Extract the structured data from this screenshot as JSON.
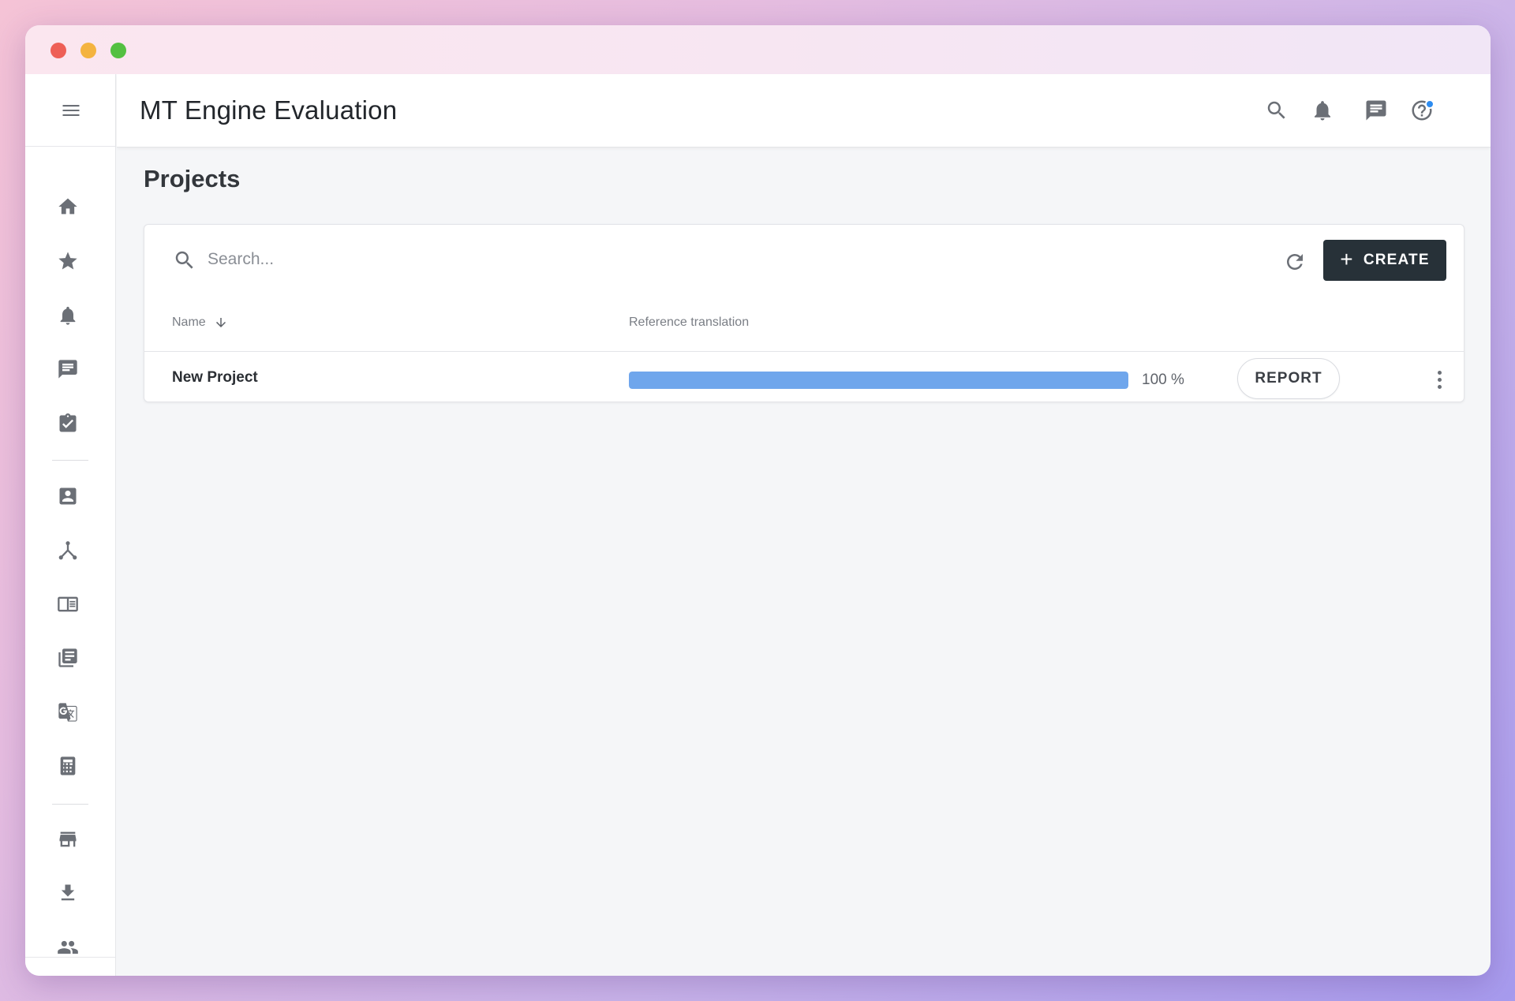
{
  "app": {
    "title": "MT Engine Evaluation"
  },
  "page": {
    "title": "Projects"
  },
  "toolbar": {
    "search_placeholder": "Search...",
    "create_label": "CREATE",
    "create_icon": "plus-icon",
    "refresh_icon": "refresh-icon"
  },
  "table": {
    "columns": [
      {
        "label": "Name",
        "sort": "descending"
      },
      {
        "label": "Reference translation"
      }
    ],
    "rows": [
      {
        "name": "New Project",
        "progress": 100,
        "progress_label": "100 %",
        "action_label": "REPORT"
      }
    ]
  },
  "header_icons": [
    "search-icon",
    "bell-icon",
    "chat-icon",
    "help-icon",
    "avatar"
  ],
  "sidebar": {
    "groups": [
      [
        "home-icon",
        "star-icon",
        "bell-icon",
        "chat-icon",
        "checkbox-icon"
      ],
      [
        "contact-icon",
        "hierarchy-icon",
        "dictionary-icon",
        "library-icon",
        "translate-icon",
        "calculator-icon"
      ],
      [
        "store-icon",
        "download-icon",
        "people-icon"
      ]
    ]
  },
  "colors": {
    "primary_button": "#273138",
    "progress": "#6fa6ec",
    "notification_dot": "#2d8cf0"
  }
}
